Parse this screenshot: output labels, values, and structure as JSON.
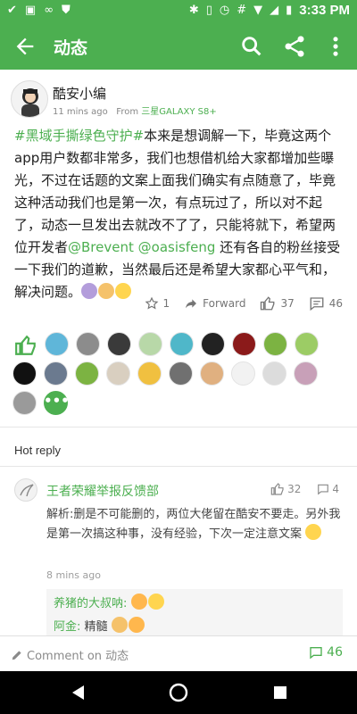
{
  "status_bar": {
    "time": "3:33 PM"
  },
  "app_bar": {
    "title": "动态"
  },
  "post": {
    "author": "酷安小编",
    "time_ago": "11 mins ago",
    "from_label": "From",
    "device": "三星GALAXY S8+",
    "hashtag": "#黑域手撕绿色守护#",
    "text_part1": "本来是想调解一下，毕竟这两个app用户数都非常多，我们也想借机给大家都增加些曝光，不过在话题的文案上面我们确实有点随意了，毕竟这种活动我们也是第一次，有点玩过了，所以对不起了，动态一旦发出去就改不了了，只能将就下，希望两位开发者",
    "mention1": "@Brevent",
    "mention2": "@oasisfeng",
    "text_part2": "还有各自的粉丝接受一下我们的道歉，当然最后还是希望大家都心平气和，解决问题。"
  },
  "actions": {
    "star_count": "1",
    "forward_label": "Forward",
    "like_count": "37",
    "comment_count": "46"
  },
  "likers": {
    "more_label": "•••",
    "avatars": [
      "#5fb6d9",
      "#8c8c8c",
      "#3a3a3a",
      "#b8d8a8",
      "#4fb7c9",
      "#222222",
      "#8b1a1a",
      "#7cb342",
      "#9ccc65",
      "#111111",
      "#6b7a8f",
      "#7cb342",
      "#d9cfc0",
      "#f0c040",
      "#707070",
      "#e0b080",
      "#f2f2f2",
      "#dcdcdc",
      "#c8a0b8",
      "#9a9a9a"
    ]
  },
  "hot_reply": {
    "heading": "Hot reply",
    "author": "王者荣耀举报反馈部",
    "likes": "32",
    "comments": "4",
    "text": "解析:删是不可能删的，两位大佬留在酷安不要走。另外我是第一次搞这种事，没有经验，下次一定注意文案",
    "time_ago": "8 mins ago"
  },
  "sub_replies": [
    {
      "name": "养猪的大叔呐:",
      "text": ""
    },
    {
      "name": "阿金:",
      "text": " 精髓"
    }
  ],
  "bottom": {
    "comment_placeholder": "Comment on 动态",
    "count": "46"
  },
  "colors": {
    "accent": "#4caf50"
  }
}
